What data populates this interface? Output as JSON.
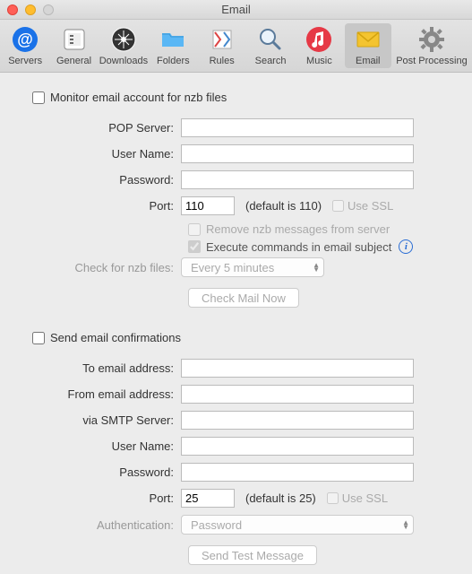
{
  "window": {
    "title": "Email"
  },
  "toolbar": {
    "items": [
      {
        "label": "Servers"
      },
      {
        "label": "General"
      },
      {
        "label": "Downloads"
      },
      {
        "label": "Folders"
      },
      {
        "label": "Rules"
      },
      {
        "label": "Search"
      },
      {
        "label": "Music"
      },
      {
        "label": "Email"
      },
      {
        "label": "Post Processing"
      }
    ]
  },
  "section1": {
    "monitor_label": "Monitor email account for nzb files",
    "pop_label": "POP Server:",
    "user_label": "User Name:",
    "pass_label": "Password:",
    "port_label": "Port:",
    "port_value": "110",
    "port_hint": "(default is 110)",
    "use_ssl_label": "Use SSL",
    "remove_label": "Remove nzb messages from server",
    "execute_label": "Execute commands in email subject",
    "check_label": "Check for nzb files:",
    "check_interval": "Every 5 minutes",
    "check_now_btn": "Check Mail Now"
  },
  "section2": {
    "send_label": "Send email confirmations",
    "to_label": "To email address:",
    "from_label": "From email address:",
    "smtp_label": "via SMTP Server:",
    "user_label": "User Name:",
    "pass_label": "Password:",
    "port_label": "Port:",
    "port_value": "25",
    "port_hint": "(default is 25)",
    "use_ssl_label": "Use SSL",
    "auth_label": "Authentication:",
    "auth_value": "Password",
    "send_test_btn": "Send Test Message"
  }
}
